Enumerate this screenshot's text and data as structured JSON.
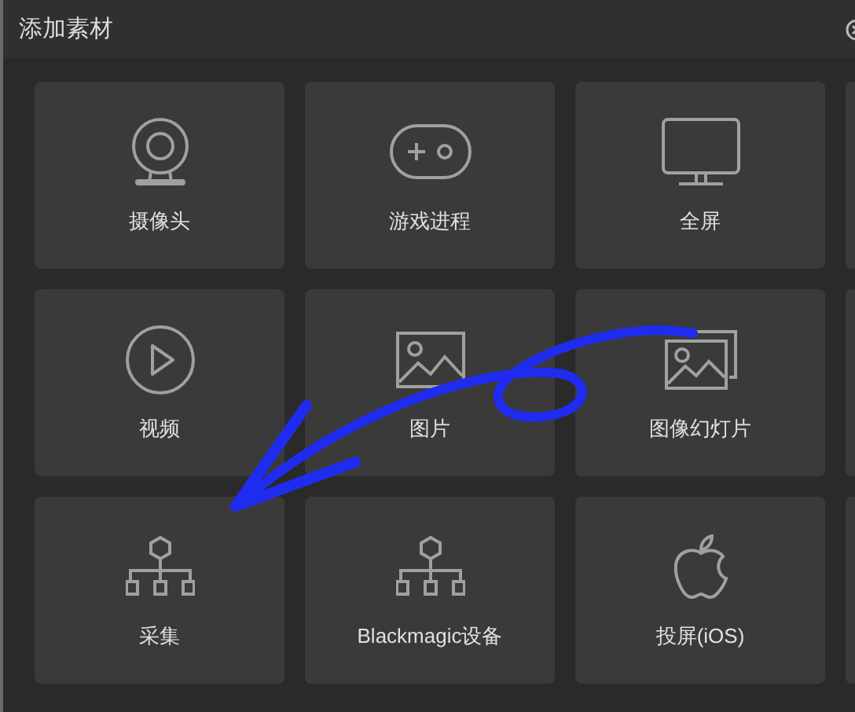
{
  "window": {
    "title": "添加素材"
  },
  "tiles": [
    {
      "kind": "webcam",
      "label": "摄像头"
    },
    {
      "kind": "gamepad",
      "label": "游戏进程"
    },
    {
      "kind": "monitor",
      "label": "全屏"
    },
    {
      "kind": "blank"
    },
    {
      "kind": "play",
      "label": "视频"
    },
    {
      "kind": "image",
      "label": "图片"
    },
    {
      "kind": "images",
      "label": "图像幻灯片"
    },
    {
      "kind": "blank"
    },
    {
      "kind": "network",
      "label": "采集"
    },
    {
      "kind": "network",
      "label": "Blackmagic设备"
    },
    {
      "kind": "apple",
      "label": "投屏(iOS)"
    },
    {
      "kind": "blank"
    }
  ]
}
